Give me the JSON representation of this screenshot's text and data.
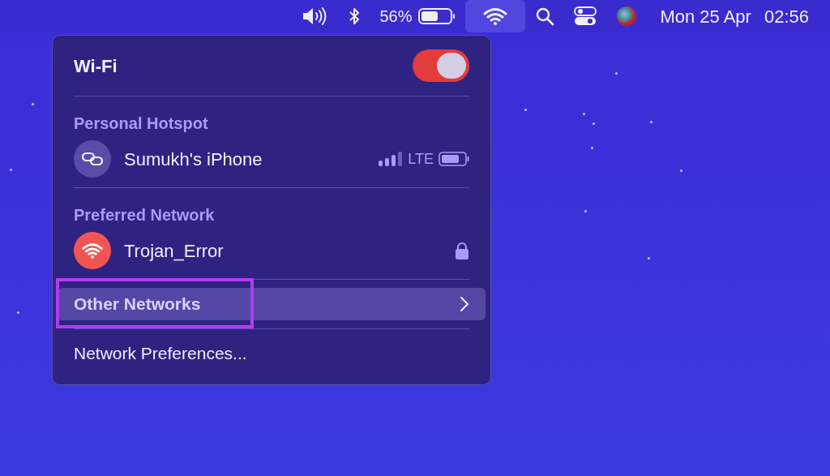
{
  "menu_bar": {
    "items": [
      {
        "kind": "volume",
        "selected": false
      },
      {
        "kind": "bluetooth",
        "selected": false
      },
      {
        "kind": "battery",
        "selected": false,
        "label": "56%"
      },
      {
        "kind": "wifi",
        "selected": true
      },
      {
        "kind": "search",
        "selected": false
      },
      {
        "kind": "control",
        "selected": false
      },
      {
        "kind": "siri",
        "selected": false
      }
    ],
    "date": "Mon 25 Apr",
    "time": "02:56"
  },
  "wifi_menu": {
    "title": "Wi-Fi",
    "on": true,
    "sections": [
      {
        "heading": "Personal Hotspot",
        "networks": [
          {
            "kind": "hotspot",
            "name": "Sumukh's iPhone",
            "network_type": "LTE"
          }
        ]
      },
      {
        "heading": "Preferred Network",
        "networks": [
          {
            "kind": "wifi",
            "name": "Trojan_Error",
            "locked": true
          }
        ]
      }
    ],
    "items": [
      {
        "kind": "submenu",
        "label": "Other Networks",
        "hovered": true,
        "annotated": true
      },
      {
        "kind": "action",
        "label": "Network Preferences...",
        "hovered": false,
        "annotated": false
      }
    ]
  }
}
